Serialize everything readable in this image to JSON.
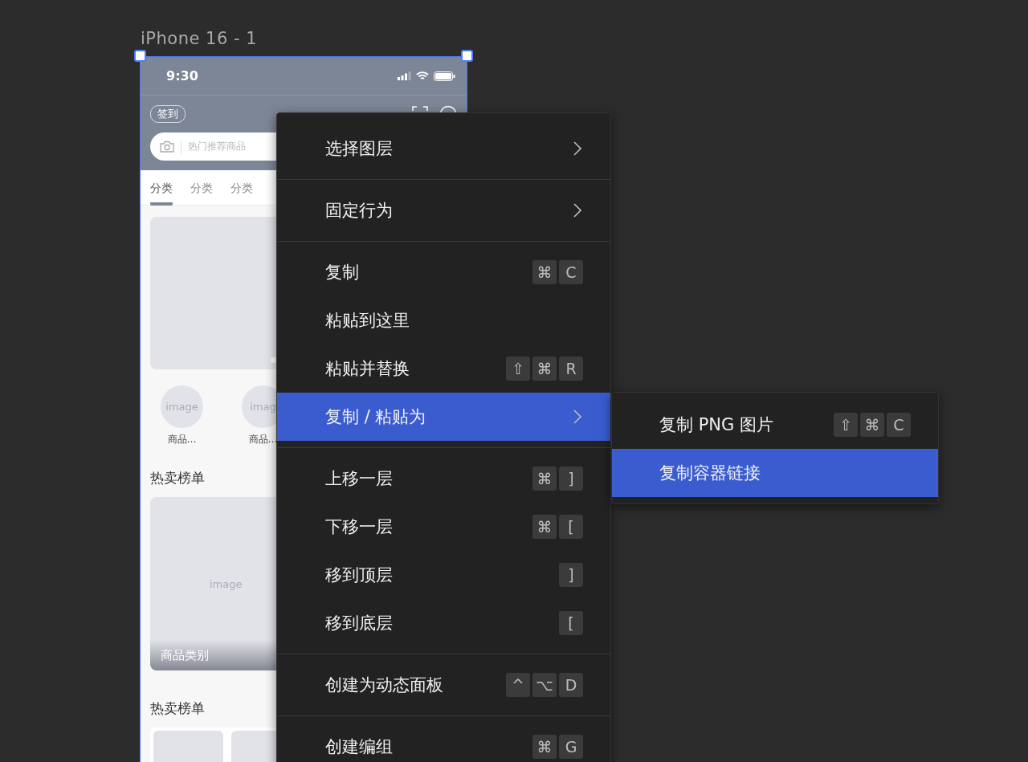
{
  "frame_label": "iPhone 16 - 1",
  "phone": {
    "status_bar": {
      "time": "9:30"
    },
    "nav": {
      "checkin": "签到"
    },
    "search": {
      "placeholder": "热门推荐商品"
    },
    "tabs": [
      {
        "label": "分类",
        "selected": true
      },
      {
        "label": "分类",
        "selected": false
      },
      {
        "label": "分类",
        "selected": false
      }
    ],
    "categories": [
      {
        "image": "image",
        "label": "商品…"
      },
      {
        "image": "imag",
        "label": "商品…"
      }
    ],
    "hot_section": {
      "title": "热卖榜单",
      "card_image": "image",
      "card_caption": "商品类别"
    },
    "hot_section_2": {
      "title": "热卖榜单"
    }
  },
  "context_menu": {
    "groups": [
      {
        "items": [
          {
            "label": "选择图层",
            "kind": "submenu",
            "selected": false
          }
        ]
      },
      {
        "items": [
          {
            "label": "固定行为",
            "kind": "submenu",
            "selected": false
          }
        ]
      },
      {
        "items": [
          {
            "label": "复制",
            "kind": "command",
            "selected": false,
            "keys": [
              "⌘",
              "C"
            ]
          },
          {
            "label": "粘贴到这里",
            "kind": "command",
            "selected": false
          },
          {
            "label": "粘贴并替换",
            "kind": "command",
            "selected": false,
            "keys": [
              "⇧",
              "⌘",
              "R"
            ]
          },
          {
            "label": "复制 / 粘贴为",
            "kind": "submenu",
            "selected": true
          }
        ]
      },
      {
        "items": [
          {
            "label": "上移一层",
            "kind": "command",
            "selected": false,
            "keys": [
              "⌘",
              "]"
            ]
          },
          {
            "label": "下移一层",
            "kind": "command",
            "selected": false,
            "keys": [
              "⌘",
              "["
            ]
          },
          {
            "label": "移到顶层",
            "kind": "command",
            "selected": false,
            "keys": [
              "]"
            ]
          },
          {
            "label": "移到底层",
            "kind": "command",
            "selected": false,
            "keys": [
              "["
            ]
          }
        ]
      },
      {
        "items": [
          {
            "label": "创建为动态面板",
            "kind": "command",
            "selected": false,
            "keys": [
              "^",
              "⌥",
              "D"
            ]
          }
        ]
      },
      {
        "items": [
          {
            "label": "创建编组",
            "kind": "command",
            "selected": false,
            "keys": [
              "⌘",
              "G"
            ]
          }
        ]
      }
    ]
  },
  "submenu": {
    "items": [
      {
        "label": "复制 PNG 图片",
        "kind": "command",
        "selected": false,
        "keys": [
          "⇧",
          "⌘",
          "C"
        ]
      },
      {
        "label": "复制容器链接",
        "kind": "command",
        "selected": true
      }
    ]
  }
}
